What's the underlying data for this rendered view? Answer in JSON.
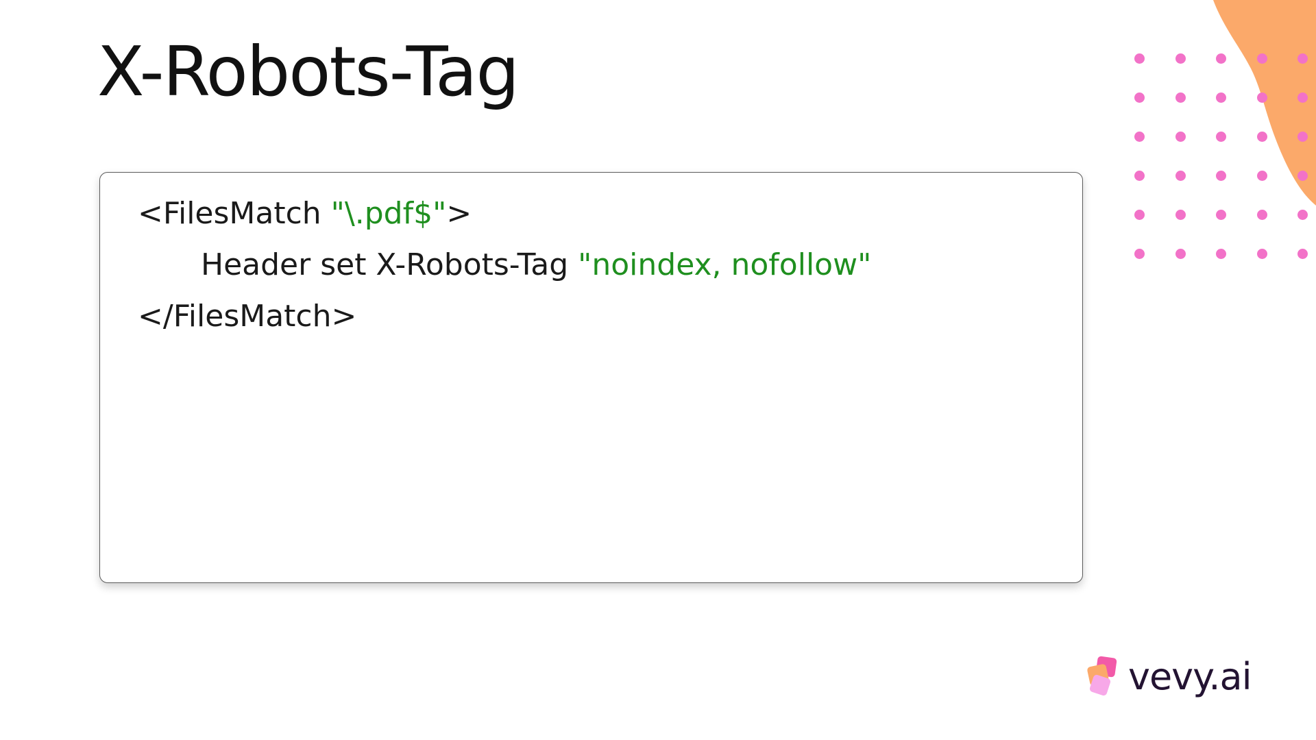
{
  "slide": {
    "title": "X-Robots-Tag"
  },
  "code": {
    "line1": {
      "open": "<FilesMatch ",
      "string": "\"\\.pdf$\"",
      "close": ">"
    },
    "line2": {
      "text": "Header set X-Robots-Tag ",
      "string": "\"noindex, nofollow\""
    },
    "line3": {
      "text": "</FilesMatch>"
    }
  },
  "brand": {
    "logo_text": "vevy.ai",
    "logo_icon": "vevy-logo-icon"
  },
  "colors": {
    "code_string": "#1f8f1f",
    "dot_pink": "#f272c8",
    "blob_orange": "#fba96a",
    "logo_dark": "#231332"
  }
}
